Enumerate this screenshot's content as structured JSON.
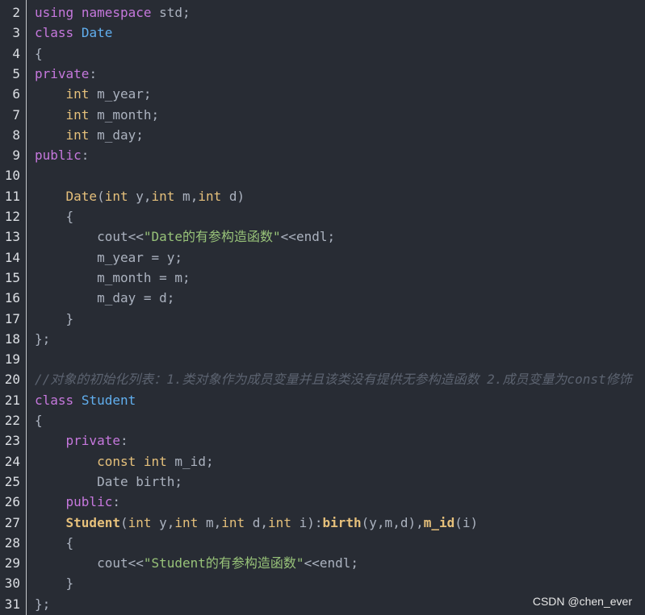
{
  "editor": {
    "lines": [
      {
        "n": "2",
        "tokens": [
          [
            "kw",
            "using"
          ],
          [
            "txt",
            " "
          ],
          [
            "kw",
            "namespace"
          ],
          [
            "txt",
            " std;"
          ]
        ]
      },
      {
        "n": "3",
        "tokens": [
          [
            "kw",
            "class"
          ],
          [
            "txt",
            " "
          ],
          [
            "cls",
            "Date"
          ]
        ]
      },
      {
        "n": "4",
        "tokens": [
          [
            "txt",
            "{"
          ]
        ]
      },
      {
        "n": "5",
        "tokens": [
          [
            "kw",
            "private"
          ],
          [
            "txt",
            ":"
          ]
        ]
      },
      {
        "n": "6",
        "tokens": [
          [
            "txt",
            "    "
          ],
          [
            "type",
            "int"
          ],
          [
            "txt",
            " m_year;"
          ]
        ]
      },
      {
        "n": "7",
        "tokens": [
          [
            "txt",
            "    "
          ],
          [
            "type",
            "int"
          ],
          [
            "txt",
            " m_month;"
          ]
        ]
      },
      {
        "n": "8",
        "tokens": [
          [
            "txt",
            "    "
          ],
          [
            "type",
            "int"
          ],
          [
            "txt",
            " m_day;"
          ]
        ]
      },
      {
        "n": "9",
        "tokens": [
          [
            "kw",
            "public"
          ],
          [
            "txt",
            ":"
          ]
        ]
      },
      {
        "n": "10",
        "tokens": []
      },
      {
        "n": "11",
        "tokens": [
          [
            "txt",
            "    "
          ],
          [
            "fn",
            "Date"
          ],
          [
            "txt",
            "("
          ],
          [
            "type",
            "int"
          ],
          [
            "txt",
            " y,"
          ],
          [
            "type",
            "int"
          ],
          [
            "txt",
            " m,"
          ],
          [
            "type",
            "int"
          ],
          [
            "txt",
            " d)"
          ]
        ]
      },
      {
        "n": "12",
        "tokens": [
          [
            "txt",
            "    {"
          ]
        ]
      },
      {
        "n": "13",
        "tokens": [
          [
            "txt",
            "        cout<<"
          ],
          [
            "str",
            "\"Date的有参构造函数\""
          ],
          [
            "txt",
            "<<endl;"
          ]
        ]
      },
      {
        "n": "14",
        "tokens": [
          [
            "txt",
            "        m_year = y;"
          ]
        ]
      },
      {
        "n": "15",
        "tokens": [
          [
            "txt",
            "        m_month = m;"
          ]
        ]
      },
      {
        "n": "16",
        "tokens": [
          [
            "txt",
            "        m_day = d;"
          ]
        ]
      },
      {
        "n": "17",
        "tokens": [
          [
            "txt",
            "    }"
          ]
        ]
      },
      {
        "n": "18",
        "tokens": [
          [
            "txt",
            "};"
          ]
        ]
      },
      {
        "n": "19",
        "tokens": []
      },
      {
        "n": "20",
        "tokens": [
          [
            "com",
            "//对象的初始化列表：1.类对象作为成员变量并且该类没有提供无参构造函数 2.成员变量为const修饰"
          ]
        ]
      },
      {
        "n": "21",
        "tokens": [
          [
            "kw",
            "class"
          ],
          [
            "txt",
            " "
          ],
          [
            "cls",
            "Student"
          ]
        ]
      },
      {
        "n": "22",
        "tokens": [
          [
            "txt",
            "{"
          ]
        ]
      },
      {
        "n": "23",
        "tokens": [
          [
            "txt",
            "    "
          ],
          [
            "kw",
            "private"
          ],
          [
            "txt",
            ":"
          ]
        ]
      },
      {
        "n": "24",
        "tokens": [
          [
            "txt",
            "        "
          ],
          [
            "type",
            "const"
          ],
          [
            "txt",
            " "
          ],
          [
            "type",
            "int"
          ],
          [
            "txt",
            " m_id;"
          ]
        ]
      },
      {
        "n": "25",
        "tokens": [
          [
            "txt",
            "        Date birth;"
          ]
        ]
      },
      {
        "n": "26",
        "tokens": [
          [
            "txt",
            "    "
          ],
          [
            "kw",
            "public"
          ],
          [
            "txt",
            ":"
          ]
        ]
      },
      {
        "n": "27",
        "tokens": [
          [
            "txt",
            "    "
          ],
          [
            "fnb",
            "Student"
          ],
          [
            "txt",
            "("
          ],
          [
            "type",
            "int"
          ],
          [
            "txt",
            " y,"
          ],
          [
            "type",
            "int"
          ],
          [
            "txt",
            " m,"
          ],
          [
            "type",
            "int"
          ],
          [
            "txt",
            " d,"
          ],
          [
            "type",
            "int"
          ],
          [
            "txt",
            " i):"
          ],
          [
            "fnb",
            "birth"
          ],
          [
            "txt",
            "(y,m,d),"
          ],
          [
            "fnb",
            "m_id"
          ],
          [
            "txt",
            "(i)"
          ]
        ]
      },
      {
        "n": "28",
        "tokens": [
          [
            "txt",
            "    {"
          ]
        ]
      },
      {
        "n": "29",
        "tokens": [
          [
            "txt",
            "        cout<<"
          ],
          [
            "str",
            "\"Student的有参构造函数\""
          ],
          [
            "txt",
            "<<endl;"
          ]
        ]
      },
      {
        "n": "30",
        "tokens": [
          [
            "txt",
            "    }"
          ]
        ]
      },
      {
        "n": "31",
        "tokens": [
          [
            "txt",
            "};"
          ]
        ]
      }
    ]
  },
  "watermark": {
    "text": "CSDN @chen_ever"
  }
}
